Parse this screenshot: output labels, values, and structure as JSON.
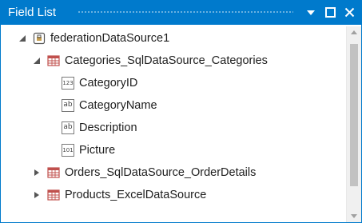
{
  "panel": {
    "title": "Field List",
    "buttons": [
      "dropdown",
      "maximize",
      "close"
    ]
  },
  "tree": {
    "root": {
      "label": "federationDataSource1",
      "icon": "database-icon",
      "expanded": true
    },
    "categories": {
      "label": "Categories_SqlDataSource_Categories",
      "icon": "table-icon",
      "expanded": true
    },
    "fields": [
      {
        "label": "CategoryID",
        "type_badge": "123"
      },
      {
        "label": "CategoryName",
        "type_badge": "ab"
      },
      {
        "label": "Description",
        "type_badge": "ab"
      },
      {
        "label": "Picture",
        "type_badge": "101"
      }
    ],
    "orders": {
      "label": "Orders_SqlDataSource_OrderDetails",
      "icon": "table-icon",
      "expanded": false
    },
    "products": {
      "label": "Products_ExcelDataSource",
      "icon": "table-icon",
      "expanded": false
    }
  },
  "colors": {
    "accent": "#007acc",
    "scrollbar_thumb": "#c2c2c2",
    "table_icon": "#c0504d"
  }
}
